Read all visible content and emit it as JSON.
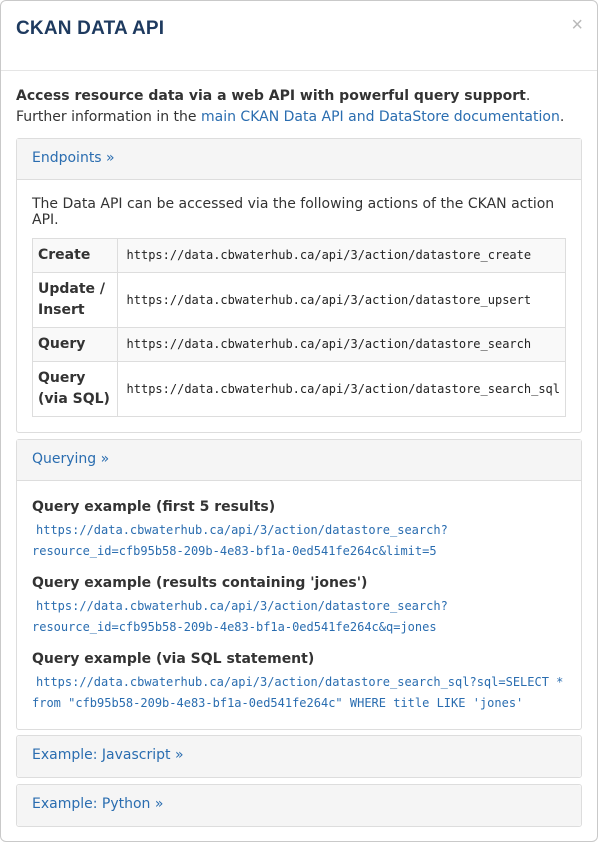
{
  "modal": {
    "title": "CKAN DATA API",
    "close_label": "×"
  },
  "intro": {
    "text_before": "Access resource data via a web API with powerful query support",
    "text_middle": ". Further information in the ",
    "link_text": "main CKAN Data API and DataStore documentation",
    "text_after": "."
  },
  "endpoints": {
    "heading": "Endpoints »",
    "description": "The Data API can be accessed via the following actions of the CKAN action API.",
    "rows": [
      {
        "label": "Create",
        "url": "https://data.cbwaterhub.ca/api/3/action/datastore_create"
      },
      {
        "label": "Update / Insert",
        "url": "https://data.cbwaterhub.ca/api/3/action/datastore_upsert"
      },
      {
        "label": "Query",
        "url": "https://data.cbwaterhub.ca/api/3/action/datastore_search"
      },
      {
        "label": "Query (via SQL)",
        "url": "https://data.cbwaterhub.ca/api/3/action/datastore_search_sql"
      }
    ]
  },
  "querying": {
    "heading": "Querying »",
    "examples": [
      {
        "title": "Query example (first 5 results)",
        "line1": "https://data.cbwaterhub.ca/api/3/action/datastore_search?",
        "line2": "resource_id=cfb95b58-209b-4e83-bf1a-0ed541fe264c&limit=5"
      },
      {
        "title": "Query example (results containing 'jones')",
        "line1": "https://data.cbwaterhub.ca/api/3/action/datastore_search?",
        "line2": "resource_id=cfb95b58-209b-4e83-bf1a-0ed541fe264c&q=jones"
      },
      {
        "title": "Query example (via SQL statement)",
        "line1": "https://data.cbwaterhub.ca/api/3/action/datastore_search_sql?sql=SELECT *",
        "line2": "from \"cfb95b58-209b-4e83-bf1a-0ed541fe264c\" WHERE title LIKE 'jones'"
      }
    ]
  },
  "javascript": {
    "heading": "Example: Javascript »"
  },
  "python": {
    "heading": "Example: Python »"
  }
}
